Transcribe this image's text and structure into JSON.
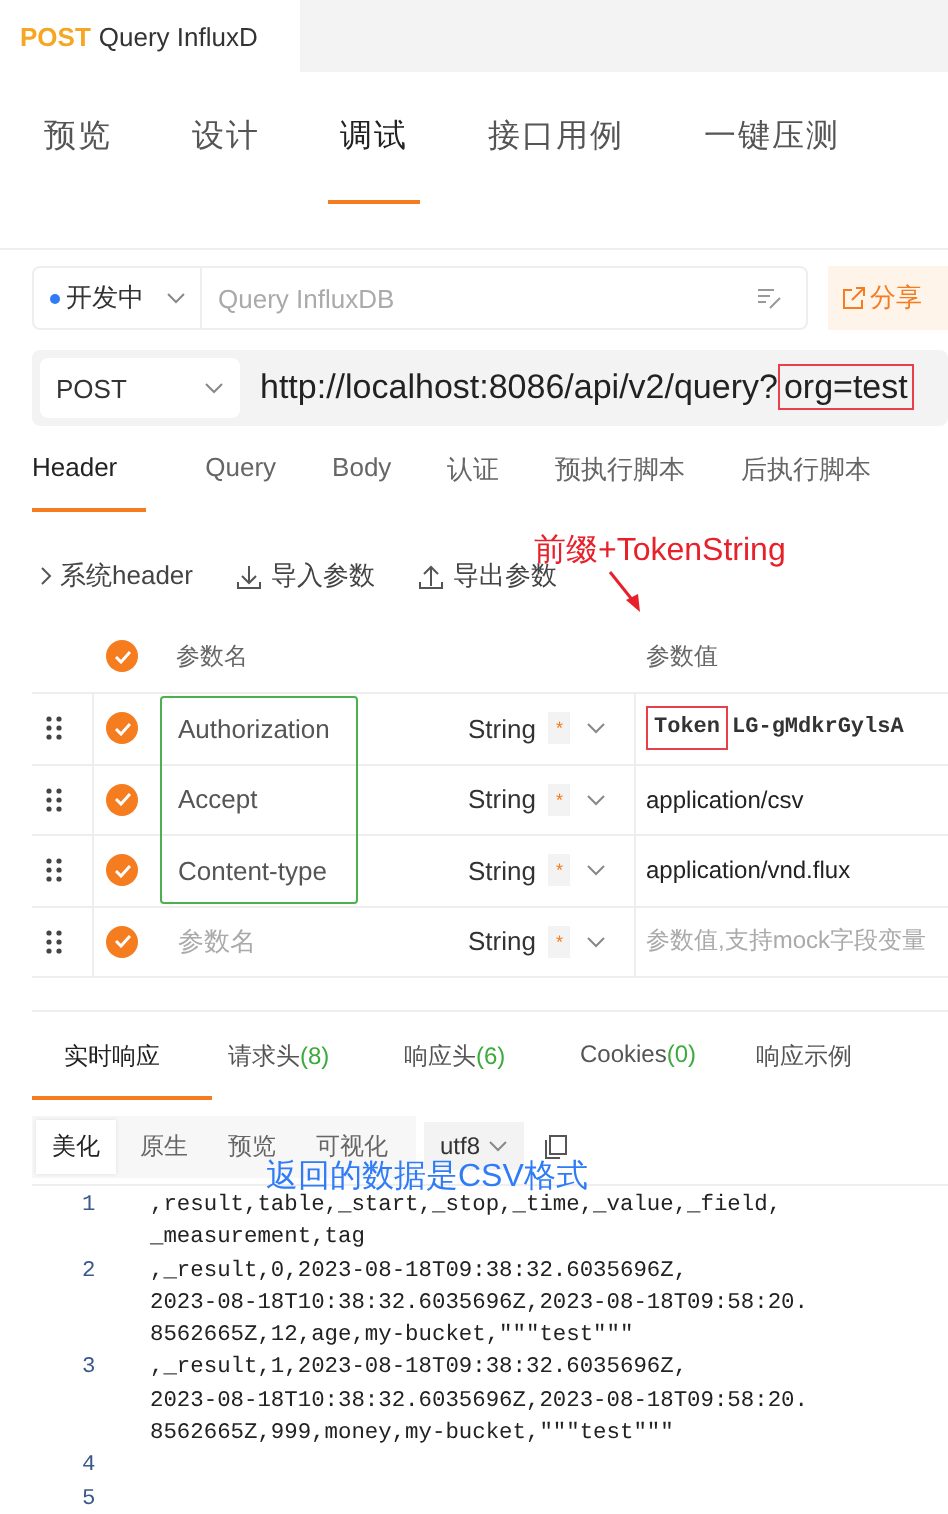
{
  "title_tab": {
    "method": "POST",
    "name": "Query InfluxD"
  },
  "main_tabs": [
    {
      "label": "预览",
      "selected": false
    },
    {
      "label": "设计",
      "selected": false
    },
    {
      "label": "调试",
      "selected": true
    },
    {
      "label": "接口用例",
      "selected": false
    },
    {
      "label": "一键压测",
      "selected": false
    }
  ],
  "environment": {
    "label": "开发中"
  },
  "name_field": {
    "placeholder": "Query InfluxDB"
  },
  "share_button": "分享",
  "request": {
    "method": "POST",
    "url": "http://localhost:8086/api/v2/query?",
    "url_highlight": "org=test"
  },
  "request_tabs": [
    {
      "label": "Header",
      "selected": true
    },
    {
      "label": "Query",
      "selected": false
    },
    {
      "label": "Body",
      "selected": false
    },
    {
      "label": "认证",
      "selected": false
    },
    {
      "label": "预执行脚本",
      "selected": false
    },
    {
      "label": "后执行脚本",
      "selected": false
    }
  ],
  "toolbar": [
    {
      "kind": "expand",
      "label": "系统header"
    },
    {
      "kind": "import",
      "label": "导入参数"
    },
    {
      "kind": "export",
      "label": "导出参数"
    }
  ],
  "params": {
    "checked": true,
    "name_column": "参数名",
    "value_column": "参数值",
    "rows": [
      {
        "checked": true,
        "name": "Authorization",
        "type": "String",
        "required": "*",
        "value_prefix": "Token",
        "value": "LG-gMdkrGylsA"
      },
      {
        "checked": true,
        "name": "Accept",
        "type": "String",
        "required": "*",
        "value": "application/csv"
      },
      {
        "checked": true,
        "name": "Content-type",
        "type": "String",
        "required": "*",
        "value": "application/vnd.flux"
      },
      {
        "checked": true,
        "name_placeholder": "参数名",
        "type": "String",
        "required": "*",
        "value_placeholder": "参数值,支持mock字段变量"
      }
    ]
  },
  "annotations": {
    "token_note": "前缀+TokenString",
    "csv_note": "返回的数据是CSV格式"
  },
  "response_tabs": [
    {
      "label": "实时响应",
      "selected": true
    },
    {
      "label": "请求头",
      "count": "(8)",
      "selected": false
    },
    {
      "label": "响应头",
      "count": "(6)",
      "selected": false
    },
    {
      "label": "Cookies",
      "count": "(0)",
      "selected": false
    },
    {
      "label": "响应示例",
      "selected": false
    }
  ],
  "view_modes": [
    {
      "label": "美化",
      "selected": true
    },
    {
      "label": "原生",
      "selected": false
    },
    {
      "label": "预览",
      "selected": false
    },
    {
      "label": "可视化",
      "selected": false
    }
  ],
  "encoding": "utf8",
  "code_lines": [
    {
      "number": "1",
      "parts": [
        ",result,table,_start,_stop,_time,_value,_field,",
        "_measurement,tag"
      ]
    },
    {
      "number": "2",
      "parts": [
        ",_result,0,2023-08-18T09:38:32.6035696Z,",
        "2023-08-18T10:38:32.6035696Z,2023-08-18T09:58:20.",
        "8562665Z,12,age,my-bucket,\"\"\"test\"\"\""
      ]
    },
    {
      "number": "3",
      "parts": [
        ",_result,1,2023-08-18T09:38:32.6035696Z,",
        "2023-08-18T10:38:32.6035696Z,2023-08-18T09:58:20.",
        "8562665Z,999,money,my-bucket,\"\"\"test\"\"\""
      ]
    },
    {
      "number": "4"
    },
    {
      "number": "5"
    }
  ]
}
